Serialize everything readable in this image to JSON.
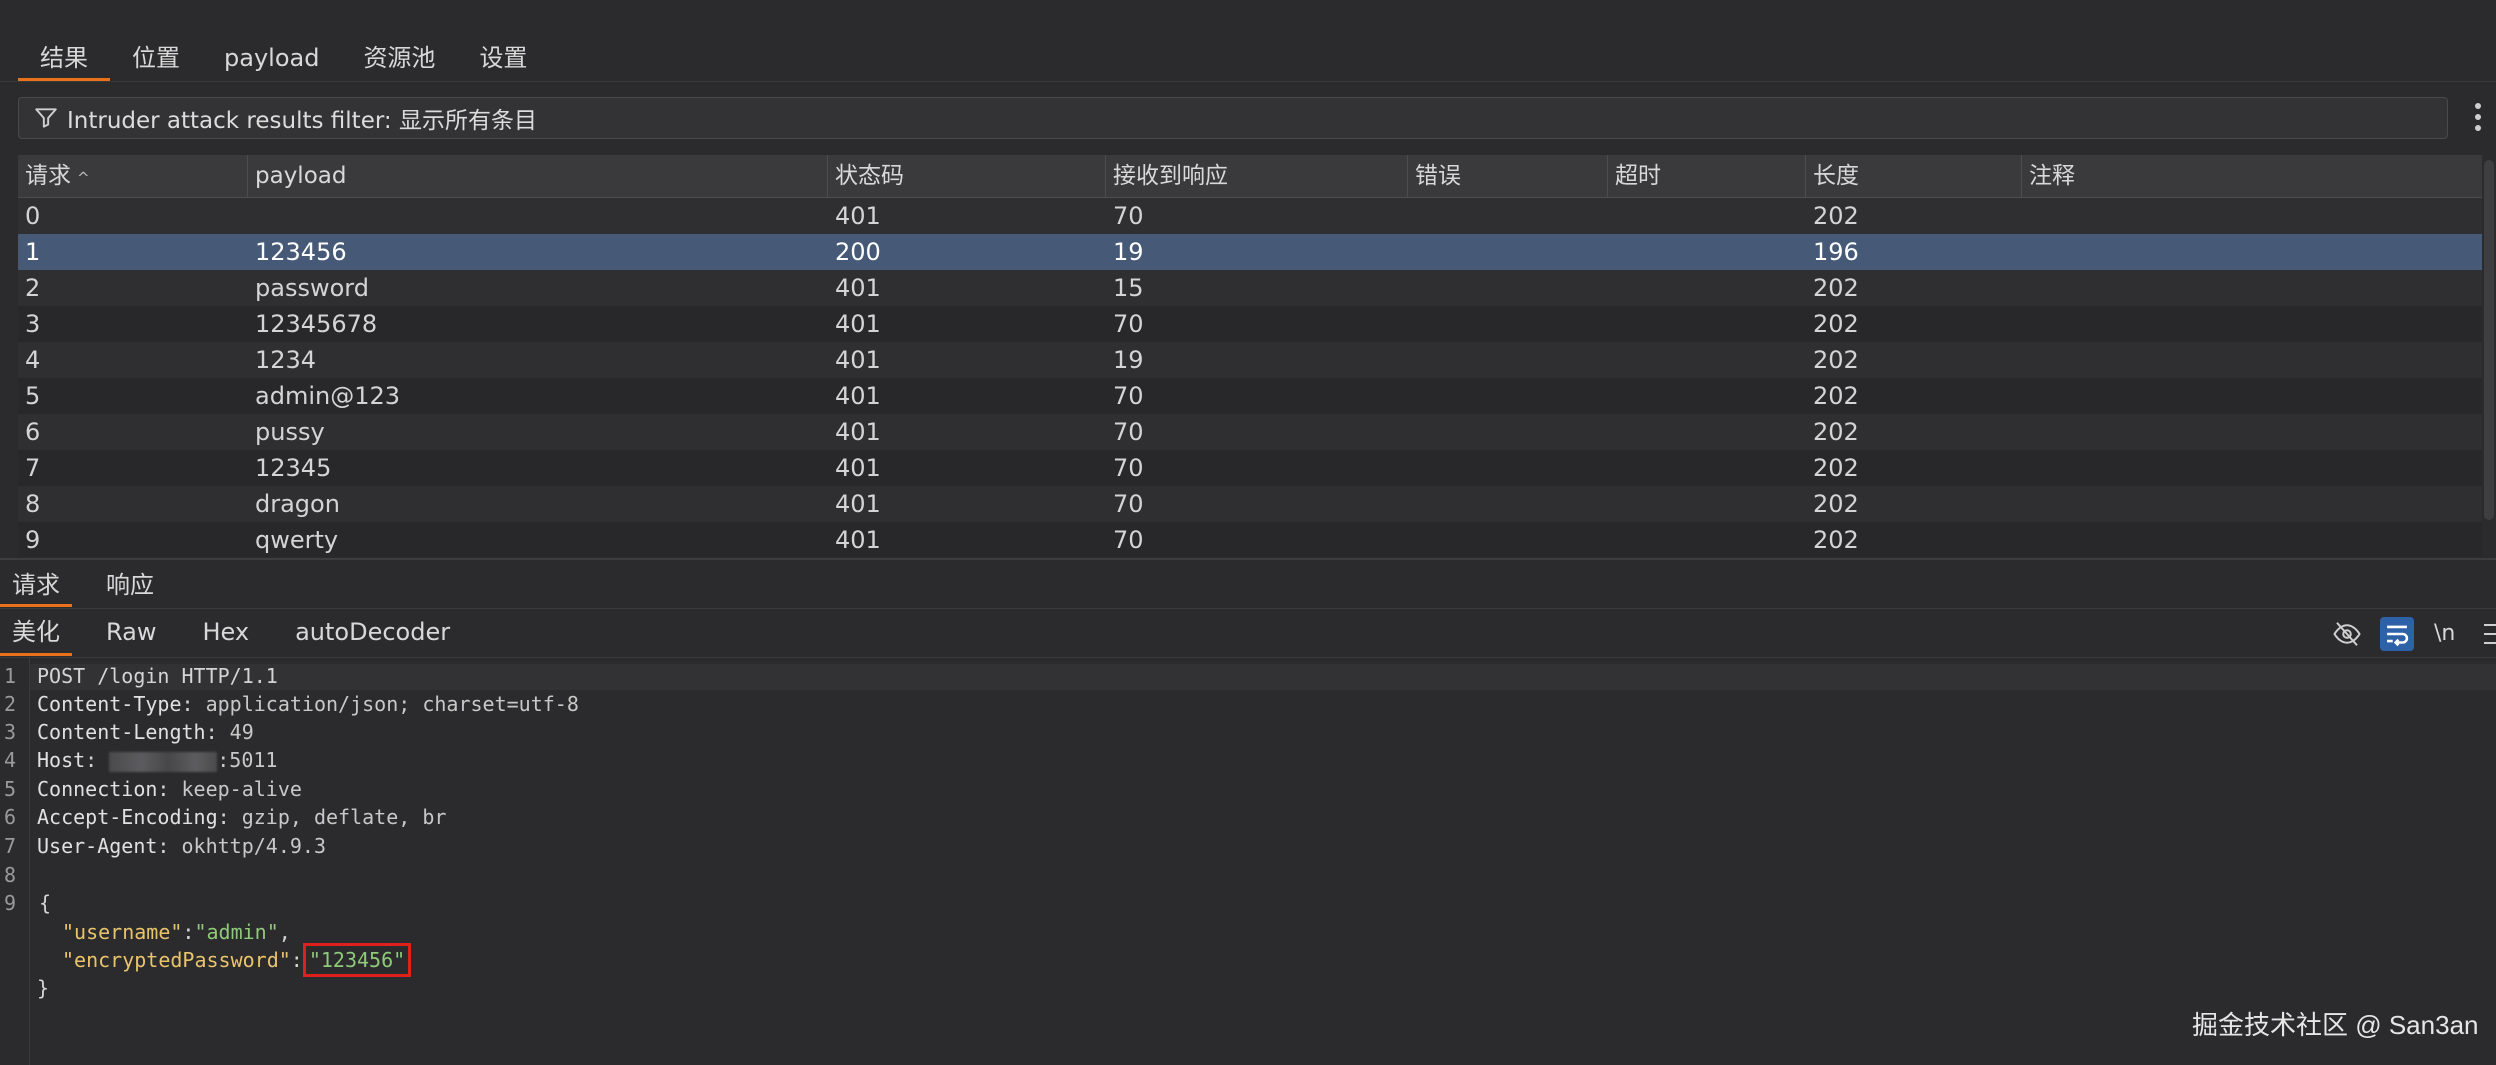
{
  "top_tabs": {
    "items": [
      {
        "label": "结果"
      },
      {
        "label": "位置"
      },
      {
        "label": "payload"
      },
      {
        "label": "资源池"
      },
      {
        "label": "设置"
      }
    ]
  },
  "filter": {
    "icon": "filter-icon",
    "label": "Intruder attack results filter: 显示所有条目"
  },
  "table": {
    "columns": [
      "请求",
      "payload",
      "状态码",
      "接收到响应",
      "错误",
      "超时",
      "长度",
      "注释"
    ],
    "sort_indicator": "^",
    "rows": [
      {
        "request": "0",
        "payload": "",
        "status": "401",
        "received": "70",
        "error": "",
        "timeout": "",
        "length": "202",
        "comment": ""
      },
      {
        "request": "1",
        "payload": "123456",
        "status": "200",
        "received": "19",
        "error": "",
        "timeout": "",
        "length": "196",
        "comment": ""
      },
      {
        "request": "2",
        "payload": "password",
        "status": "401",
        "received": "15",
        "error": "",
        "timeout": "",
        "length": "202",
        "comment": ""
      },
      {
        "request": "3",
        "payload": "12345678",
        "status": "401",
        "received": "70",
        "error": "",
        "timeout": "",
        "length": "202",
        "comment": ""
      },
      {
        "request": "4",
        "payload": "1234",
        "status": "401",
        "received": "19",
        "error": "",
        "timeout": "",
        "length": "202",
        "comment": ""
      },
      {
        "request": "5",
        "payload": "admin@123",
        "status": "401",
        "received": "70",
        "error": "",
        "timeout": "",
        "length": "202",
        "comment": ""
      },
      {
        "request": "6",
        "payload": "pussy",
        "status": "401",
        "received": "70",
        "error": "",
        "timeout": "",
        "length": "202",
        "comment": ""
      },
      {
        "request": "7",
        "payload": "12345",
        "status": "401",
        "received": "70",
        "error": "",
        "timeout": "",
        "length": "202",
        "comment": ""
      },
      {
        "request": "8",
        "payload": "dragon",
        "status": "401",
        "received": "70",
        "error": "",
        "timeout": "",
        "length": "202",
        "comment": ""
      },
      {
        "request": "9",
        "payload": "qwerty",
        "status": "401",
        "received": "70",
        "error": "",
        "timeout": "",
        "length": "202",
        "comment": ""
      }
    ]
  },
  "sub_tabs": [
    {
      "label": "请求"
    },
    {
      "label": "响应"
    }
  ],
  "view_tabs": [
    {
      "label": "美化"
    },
    {
      "label": "Raw"
    },
    {
      "label": "Hex"
    },
    {
      "label": "autoDecoder"
    }
  ],
  "toolbar": {
    "eye_icon": "eye-off-icon",
    "wrap_icon": "wrap-icon",
    "newline_label": "\\n",
    "menu_icon": "hamburger-icon"
  },
  "editor": {
    "line_numbers": [
      "1",
      "2",
      "3",
      "4",
      "5",
      "6",
      "7",
      "8",
      "9"
    ],
    "request_line": "POST /login HTTP/1.1",
    "headers": [
      {
        "name": "Content-Type",
        "value": " application/json; charset=utf-8"
      },
      {
        "name": "Content-Length",
        "value": " 49"
      },
      {
        "name": "Host",
        "value": ":5011"
      },
      {
        "name": "Connection",
        "value": " keep-alive"
      },
      {
        "name": "Accept-Encoding",
        "value": " gzip, deflate, br"
      },
      {
        "name": "User-Agent",
        "value": " okhttp/4.9.3"
      }
    ],
    "body": {
      "open_brace": "{",
      "key1": "\"username\"",
      "val1": "\"admin\"",
      "key2": "\"encryptedPassword\"",
      "val2": "\"123456\"",
      "close_brace": "}"
    }
  },
  "watermark": "掘金技术社区 @ San3an"
}
